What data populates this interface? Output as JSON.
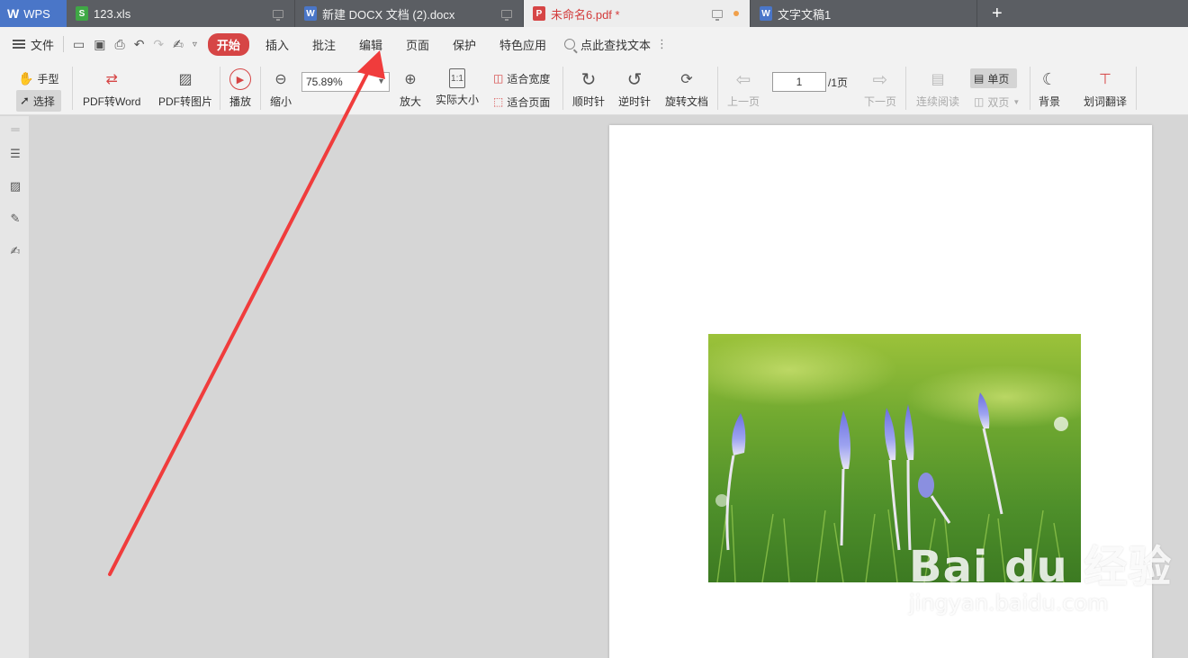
{
  "tabs": {
    "brand": "WPS",
    "items": [
      {
        "label": "123.xls",
        "icon": "S",
        "color": "#3fa845"
      },
      {
        "label": "新建 DOCX 文档 (2).docx",
        "icon": "W",
        "color": "#4a76c8"
      },
      {
        "label": "未命名6.pdf *",
        "icon": "P",
        "color": "#d64545",
        "active": true
      },
      {
        "label": "文字文稿1",
        "icon": "W",
        "color": "#4a76c8"
      }
    ],
    "new_tab": "+"
  },
  "menu": {
    "file": "文件",
    "start": "开始",
    "items": [
      "插入",
      "批注",
      "编辑",
      "页面",
      "保护",
      "特色应用"
    ],
    "search": "点此查找文本"
  },
  "toolbar": {
    "hand": "手型",
    "select": "选择",
    "pdf_to_word": "PDF转Word",
    "pdf_to_image": "PDF转图片",
    "play": "播放",
    "zoom_out": "缩小",
    "zoom_value": "75.89%",
    "zoom_in": "放大",
    "actual_size": "实际大小",
    "fit_width": "适合宽度",
    "fit_page": "适合页面",
    "rotate_cw": "顺时针",
    "rotate_ccw": "逆时针",
    "rotate_doc": "旋转文档",
    "prev_page": "上一页",
    "page_current": "1",
    "page_total": "/1页",
    "next_page": "下一页",
    "continuous": "连续阅读",
    "single": "单页",
    "double": "双页",
    "background": "背景",
    "translate": "划词翻译"
  },
  "watermark": {
    "brand": "Bai du 经验",
    "url": "jingyan.baidu.com"
  },
  "colors": {
    "tab_bg": "#5b5e63",
    "wps_blue": "#4a76c8",
    "accent_red": "#d64545",
    "toolbar_bg": "#f2f2f2",
    "workspace_bg": "#d6d6d6",
    "annotation_arrow": "#f03c3c"
  }
}
